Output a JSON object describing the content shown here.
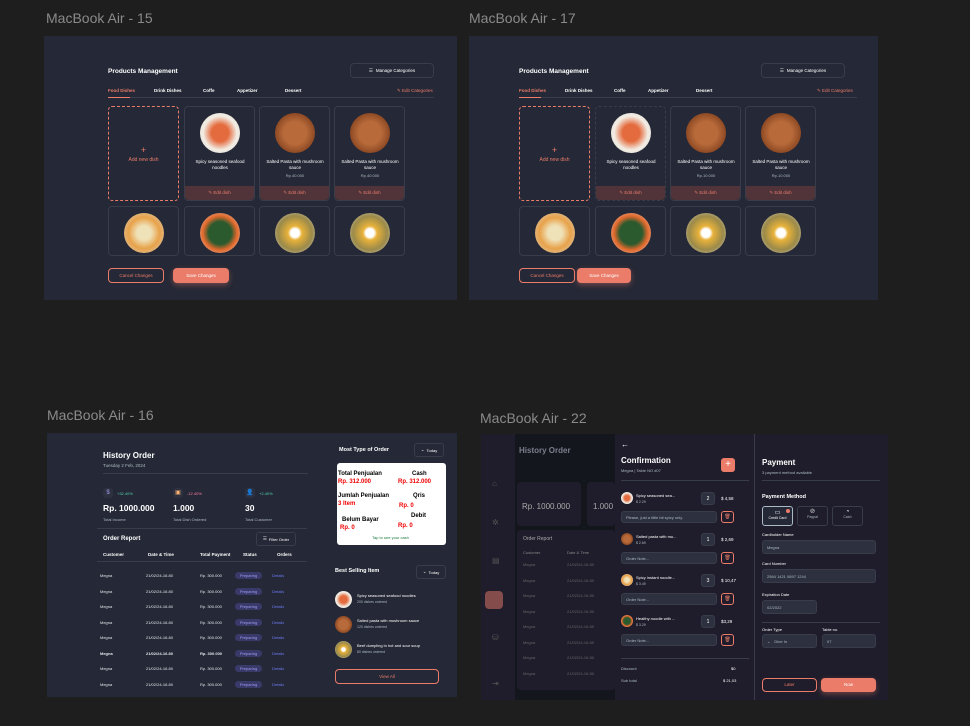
{
  "frames": {
    "f15": "MacBook Air - 15",
    "f17": "MacBook Air - 17",
    "f16": "MacBook Air - 16",
    "f22": "MacBook Air - 22"
  },
  "products": {
    "title": "Products Management",
    "manage_btn": "Manage Categories",
    "tabs": [
      "Food Dishes",
      "Drink Dishes",
      "Coffe",
      "Appetizer",
      "Dessert"
    ],
    "edit_categories": "Edit Categories",
    "add_new": "Add new dish",
    "dishes": [
      {
        "name": "Spicy seasoned seafood noodles",
        "price": "",
        "edit": "Edit dish"
      },
      {
        "name": "Salted Pasta with mushroom sauce",
        "price": "Rp.40.000",
        "edit": "Edit dish"
      },
      {
        "name": "Salted Pasta with mushroom sauce",
        "price": "Rp.40.000",
        "edit": "Edit dish"
      }
    ],
    "cancel": "Cancel Changes",
    "save": "Save Changes"
  },
  "products17": {
    "dishes": [
      {
        "name": "Spicy seasoned seafood noodles",
        "price": "",
        "edit": "Edit dish"
      },
      {
        "name": "Salted Pasta with mushroom sauce",
        "price": "Rp.10.000",
        "edit": "Edit dish"
      },
      {
        "name": "Salted Pasta with mushroom sauce",
        "price": "Rp.10.000",
        "edit": "Edit dish"
      }
    ]
  },
  "history": {
    "title": "History Order",
    "date": "Tuesday 2 Feb, 2024",
    "stats": [
      {
        "change": "+32.40%",
        "value": "Rp. 1000.000",
        "label": "Total Income"
      },
      {
        "change": "-12.40%",
        "value": "1.000",
        "label": "Total Dish Ordered"
      },
      {
        "change": "+2.40%",
        "value": "30",
        "label": "Total Customer"
      }
    ],
    "report_title": "Order Report",
    "filter": "Filter Order",
    "columns": [
      "Customer",
      "Date & Time",
      "Total Payment",
      "Status",
      "Orders"
    ],
    "rows": [
      {
        "c": "Megna",
        "d": "21/02/24-16.80",
        "p": "Rp. 300.000",
        "s": "Preparing",
        "o": "Details"
      },
      {
        "c": "Megna",
        "d": "21/02/24-16.80",
        "p": "Rp. 300.000",
        "s": "Preparing",
        "o": "Details"
      },
      {
        "c": "Megna",
        "d": "21/02/24-16.80",
        "p": "Rp. 300.000",
        "s": "Preparing",
        "o": "Details"
      },
      {
        "c": "Megna",
        "d": "21/02/24-16.80",
        "p": "Rp. 300.000",
        "s": "Preparing",
        "o": "Details"
      },
      {
        "c": "Megna",
        "d": "21/02/24-16.80",
        "p": "Rp. 300.000",
        "s": "Preparing",
        "o": "Details"
      },
      {
        "c": "Megna",
        "d": "21/02/24-16.80",
        "p": "Rp. 300.000",
        "s": "Preparing",
        "o": "Details"
      },
      {
        "c": "Megna",
        "d": "21/02/24-16.80",
        "p": "Rp. 300.000",
        "s": "Preparing",
        "o": "Details"
      },
      {
        "c": "Megna",
        "d": "21/02/24-16.80",
        "p": "Rp. 300.000",
        "s": "Preparing",
        "o": "Details"
      }
    ],
    "most_type": "Most Type of Order",
    "today": "Today",
    "popup": {
      "total_penjualan": "Total Penjualan",
      "total_val": "Rp. 312.000",
      "cash": "Cash",
      "cash_val": "Rp. 312.000",
      "jumlah": "Jumlah Penjualan",
      "jumlah_val": "3 Item",
      "qris": "Qris",
      "qris_val": "Rp. 0",
      "belum": "Belum Bayar",
      "belum_val": "Rp. 0",
      "debit": "Debit",
      "debit_val": "Rp. 0",
      "tap": "Tap to see your cash"
    },
    "best_title": "Best Selling Item",
    "best": [
      {
        "name": "Spicy seasoned seafood noodles",
        "sub": "200 dishes ordered"
      },
      {
        "name": "Salted pasta with mushroom sauce",
        "sub": "120 dishes ordered"
      },
      {
        "name": "Beef dumpling in hot and sour soup",
        "sub": "80 dishes ordered"
      }
    ],
    "view_all": "View All"
  },
  "confirm": {
    "title": "Confirmation",
    "sub": "Megna | Table NO #07",
    "items": [
      {
        "name": "Spicy seasoned sea...",
        "price": "$ 2.29",
        "qty": "2",
        "total": "$ 4,58",
        "note": "Please, just a little bit spicy only."
      },
      {
        "name": "Salted pasta with mu...",
        "price": "$ 2.69",
        "qty": "1",
        "total": "$ 2,69",
        "note": "Order Note..."
      },
      {
        "name": "Spicy instant noodle...",
        "price": "$ 3.49",
        "qty": "3",
        "total": "$ 10,47",
        "note": "Order Note..."
      },
      {
        "name": "Healthy noodle with ...",
        "price": "$ 3.29",
        "qty": "1",
        "total": "$3,29",
        "note": "Order Note..."
      }
    ],
    "discount": "Discount",
    "discount_val": "$0",
    "subtotal": "Sub total",
    "subtotal_val": "$ 21,03",
    "bg_title": "History Order",
    "bg_value": "Rp. 1000.000",
    "bg_value2": "1.000",
    "bg_report": "Order Report",
    "bg_cols": [
      "Customer",
      "Date & Time"
    ],
    "bg_rows": [
      "Megna",
      "Megna",
      "Megna",
      "Megna",
      "Megna",
      "Megna",
      "Megna",
      "Megna"
    ],
    "bg_dates": [
      "21/02/24-16.80",
      "21/02/24-16.80",
      "21/02/24-16.80",
      "21/02/24-16.80",
      "21/02/24-16.80",
      "21/02/24-16.80",
      "21/02/24-16.80",
      "21/02/24-16.80"
    ]
  },
  "payment": {
    "title": "Payment",
    "sub": "3 payment method available",
    "method_title": "Payment Method",
    "methods": [
      "Credit Card",
      "Paypal",
      "Cash"
    ],
    "cardholder_label": "Cardholder Name",
    "cardholder_val": "Megna",
    "card_label": "Card Number",
    "card_val": "2564 1421 0897 1244",
    "exp_label": "Expiration Date",
    "exp_val": "02/2022",
    "order_type_label": "Order Type",
    "order_type_val": "Dine In",
    "table_label": "Table no.",
    "table_val": "07",
    "later": "Later",
    "now": "Now"
  },
  "colors": {
    "accent": "#ea7c69",
    "bg": "#252836",
    "card": "#1f1d2b"
  }
}
